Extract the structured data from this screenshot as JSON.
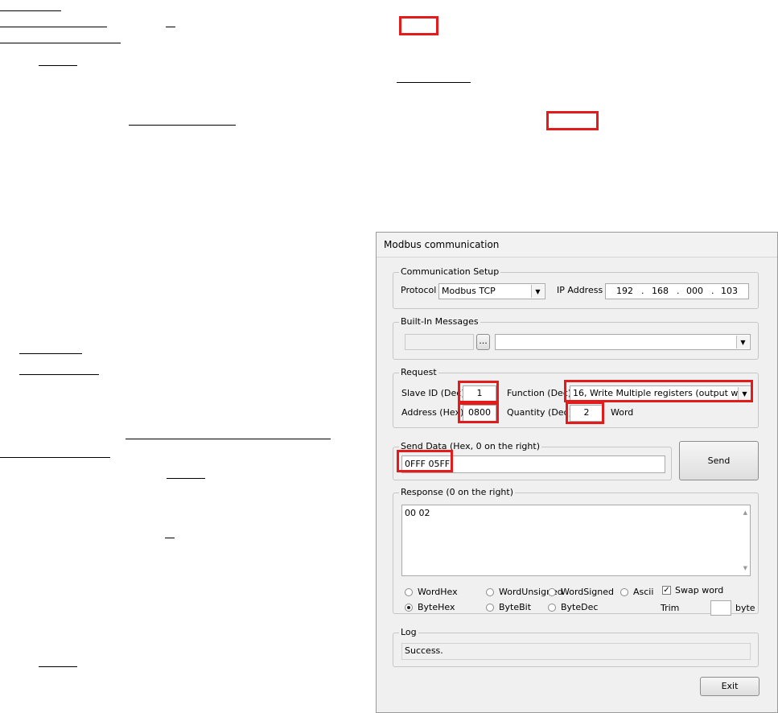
{
  "window": {
    "title": "Modbus communication"
  },
  "comm_setup": {
    "group_title": "Communication Setup",
    "protocol_label": "Protocol",
    "protocol_value": "Modbus TCP",
    "ip_label": "IP Address",
    "ip": [
      "192",
      "168",
      "000",
      "103"
    ]
  },
  "builtin": {
    "group_title": "Built-In Messages",
    "browse_label": "...",
    "message_value": ""
  },
  "request": {
    "group_title": "Request",
    "slave_label": "Slave ID (Dec)",
    "slave_value": "1",
    "function_label": "Function (Dec)",
    "function_value": "16, Write Multiple registers (output words)",
    "address_label": "Address (Hex)",
    "address_value": "0800",
    "quantity_label": "Quantity (Dec)",
    "quantity_value": "2",
    "quantity_unit": "Word"
  },
  "send": {
    "group_title": "Send Data (Hex, 0 on the right)",
    "data_value": "0FFF 05FF",
    "send_label": "Send"
  },
  "response": {
    "group_title": "Response (0 on the right)",
    "text": "00 02",
    "formats": {
      "wordhex": "WordHex",
      "wordunsigned": "WordUnsigned",
      "wordsigned": "WordSigned",
      "ascii": "Ascii",
      "bytehex": "ByteHex",
      "bytebit": "ByteBit",
      "bytedec": "ByteDec"
    },
    "selected_format": "ByteHex",
    "swap_word_label": "Swap word",
    "swap_word_checked": true,
    "trim_label": "Trim",
    "trim_value": "",
    "trim_unit": "byte"
  },
  "log": {
    "group_title": "Log",
    "text": "Success."
  },
  "exit_label": "Exit",
  "colors": {
    "highlight": "#e31b1b",
    "dialog_bg": "#f0f0f0"
  },
  "icons": {
    "dropdown": "chevron-down-icon",
    "scroll_up": "scroll-up-arrow-icon",
    "scroll_down": "scroll-down-arrow-icon"
  }
}
